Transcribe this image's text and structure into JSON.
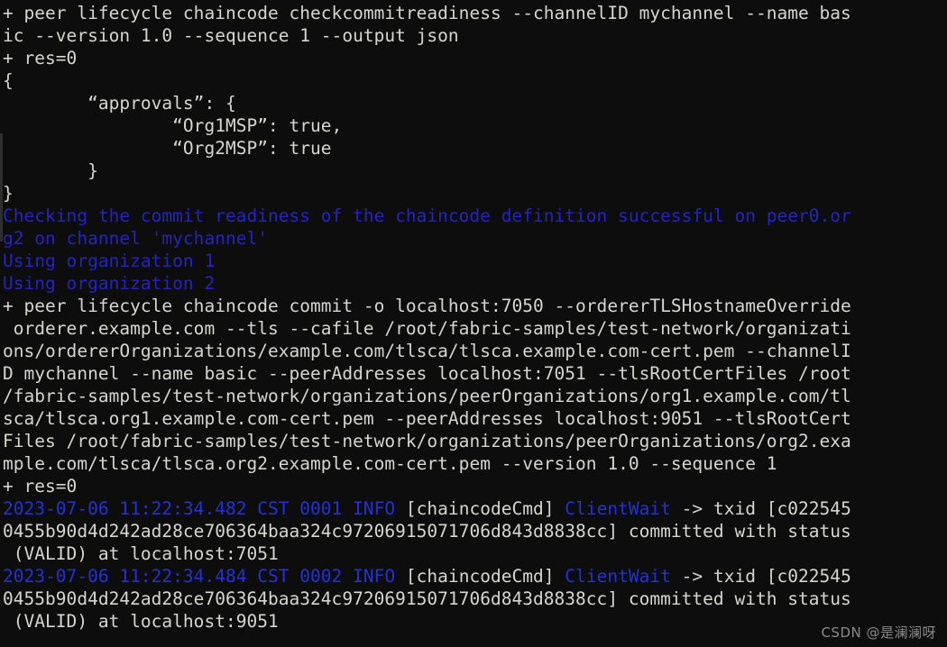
{
  "terminal": {
    "background_color": "#0d0d0d",
    "text_color": "#d6d6d0",
    "accent_blue": "#2424c4",
    "log_blue": "#2331d6",
    "lines": [
      {
        "segments": [
          {
            "text": "+ peer lifecycle chaincode checkcommitreadiness --channelID mychannel --name bas",
            "color": "white"
          }
        ]
      },
      {
        "segments": [
          {
            "text": "ic --version 1.0 --sequence 1 --output json",
            "color": "white"
          }
        ]
      },
      {
        "segments": [
          {
            "text": "+ res=0",
            "color": "white"
          }
        ]
      },
      {
        "segments": [
          {
            "text": "{",
            "color": "white"
          }
        ]
      },
      {
        "segments": [
          {
            "text": "        “approvals”: {",
            "color": "white"
          }
        ]
      },
      {
        "segments": [
          {
            "text": "                “Org1MSP”: true,",
            "color": "white"
          }
        ]
      },
      {
        "segments": [
          {
            "text": "                “Org2MSP”: true",
            "color": "white"
          }
        ]
      },
      {
        "segments": [
          {
            "text": "        }",
            "color": "white"
          }
        ]
      },
      {
        "segments": [
          {
            "text": "}",
            "color": "white"
          }
        ]
      },
      {
        "segments": [
          {
            "text": "Checking the commit readiness of the chaincode definition successful on peer0.or",
            "color": "blue"
          }
        ]
      },
      {
        "segments": [
          {
            "text": "g2 on channel 'mychannel'",
            "color": "blue"
          }
        ]
      },
      {
        "segments": [
          {
            "text": "Using organization 1",
            "color": "blue"
          }
        ]
      },
      {
        "segments": [
          {
            "text": "Using organization 2",
            "color": "blue"
          }
        ]
      },
      {
        "segments": [
          {
            "text": "+ peer lifecycle chaincode commit -o localhost:7050 --ordererTLSHostnameOverride",
            "color": "white"
          }
        ]
      },
      {
        "segments": [
          {
            "text": " orderer.example.com --tls --cafile /root/fabric-samples/test-network/organizati",
            "color": "white"
          }
        ]
      },
      {
        "segments": [
          {
            "text": "ons/ordererOrganizations/example.com/tlsca/tlsca.example.com-cert.pem --channelI",
            "color": "white"
          }
        ]
      },
      {
        "segments": [
          {
            "text": "D mychannel --name basic --peerAddresses localhost:7051 --tlsRootCertFiles /root",
            "color": "white"
          }
        ]
      },
      {
        "segments": [
          {
            "text": "/fabric-samples/test-network/organizations/peerOrganizations/org1.example.com/tl",
            "color": "white"
          }
        ]
      },
      {
        "segments": [
          {
            "text": "sca/tlsca.org1.example.com-cert.pem --peerAddresses localhost:9051 --tlsRootCert",
            "color": "white"
          }
        ]
      },
      {
        "segments": [
          {
            "text": "Files /root/fabric-samples/test-network/organizations/peerOrganizations/org2.exa",
            "color": "white"
          }
        ]
      },
      {
        "segments": [
          {
            "text": "mple.com/tlsca/tlsca.org2.example.com-cert.pem --version 1.0 --sequence 1",
            "color": "white"
          }
        ]
      },
      {
        "segments": [
          {
            "text": "+ res=0",
            "color": "white"
          }
        ]
      },
      {
        "segments": [
          {
            "text": "2023-07-06 11:22:34.482 CST 0001 INFO ",
            "color": "log_blue"
          },
          {
            "text": "[chaincodeCmd] ",
            "color": "white"
          },
          {
            "text": "ClientWait",
            "color": "log_blue"
          },
          {
            "text": " -> txid [c022545",
            "color": "white"
          }
        ]
      },
      {
        "segments": [
          {
            "text": "0455b90d4d242ad28ce706364baa324c97206915071706d843d8838cc] committed with status",
            "color": "white"
          }
        ]
      },
      {
        "segments": [
          {
            "text": " (VALID) at localhost:7051",
            "color": "white"
          }
        ]
      },
      {
        "segments": [
          {
            "text": "2023-07-06 11:22:34.484 CST 0002 INFO ",
            "color": "log_blue"
          },
          {
            "text": "[chaincodeCmd] ",
            "color": "white"
          },
          {
            "text": "ClientWait",
            "color": "log_blue"
          },
          {
            "text": " -> txid [c022545",
            "color": "white"
          }
        ]
      },
      {
        "segments": [
          {
            "text": "0455b90d4d242ad28ce706364baa324c97206915071706d843d8838cc] committed with status",
            "color": "white"
          }
        ]
      },
      {
        "segments": [
          {
            "text": " (VALID) at localhost:9051",
            "color": "white"
          }
        ]
      }
    ]
  },
  "watermark": {
    "text": "CSDN @是澜澜呀"
  }
}
